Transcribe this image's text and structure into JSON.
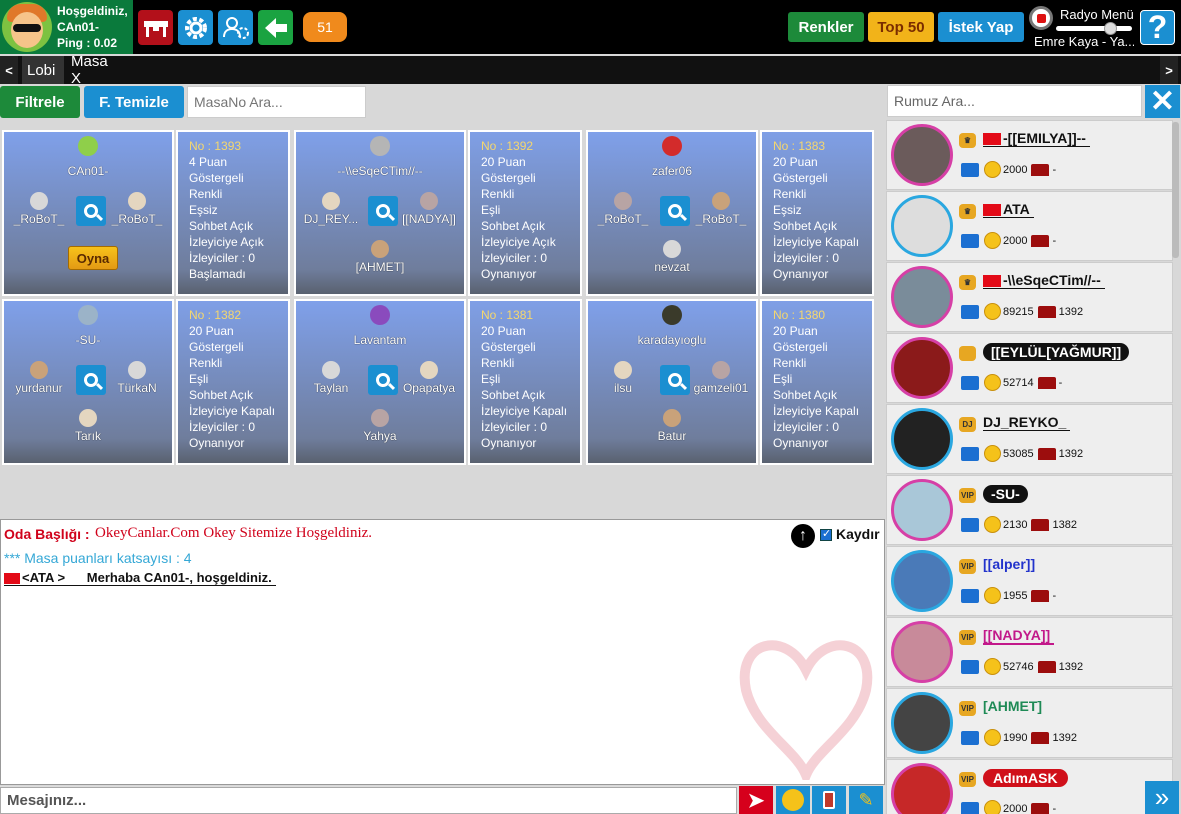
{
  "header": {
    "welcome_line1": "Hoşgeldiniz,",
    "welcome_line2": "CAn01-",
    "welcome_line3": "Ping : 0.02",
    "count_badge": "51",
    "renkler": "Renkler",
    "top50": "Top 50",
    "istek": "İstek Yap",
    "radio_label": "Radyo Menü",
    "radio_song": "Emre Kaya - Ya...",
    "help": "?"
  },
  "tabs": {
    "prev": "<",
    "lobi": "Lobi",
    "masa": "Masa X",
    "next": ">"
  },
  "filter": {
    "filtrele": "Filtrele",
    "temizle": "F. Temizle",
    "masa_placeholder": "MasaNo Ara..."
  },
  "tables": [
    {
      "owner": "CAn01-",
      "seat_left": "_RoBoT_",
      "seat_right": "_RoBoT_",
      "seat_bottom": "",
      "button": "Oyna",
      "info": {
        "no": "No : 1393",
        "puan": "4 Puan",
        "l1": "Göstergeli",
        "l2": "Renkli",
        "l3": "Eşsiz",
        "l4": "Sohbet Açık",
        "l5": "İzleyiciye Açık",
        "l6": "İzleyiciler : 0",
        "status": "Başlamadı"
      }
    },
    {
      "owner": "--\\\\eSqeCTim//--",
      "seat_left": "DJ_REY...",
      "seat_right": "[[NADYA]]",
      "seat_bottom": "[AHMET]",
      "button": "",
      "info": {
        "no": "No : 1392",
        "puan": "20 Puan",
        "l1": "Göstergeli",
        "l2": "Renkli",
        "l3": "Eşli",
        "l4": "Sohbet Açık",
        "l5": "İzleyiciye Açık",
        "l6": "İzleyiciler : 0",
        "status": "Oynanıyor"
      }
    },
    {
      "owner": "zafer06",
      "seat_left": "_RoBoT_",
      "seat_right": "_RoBoT_",
      "seat_bottom": "nevzat",
      "button": "",
      "info": {
        "no": "No : 1383",
        "puan": "20 Puan",
        "l1": "Göstergeli",
        "l2": "Renkli",
        "l3": "Eşsiz",
        "l4": "Sohbet Açık",
        "l5": "İzleyiciye Kapalı",
        "l6": "İzleyiciler : 0",
        "status": "Oynanıyor"
      }
    },
    {
      "owner": "-SU-",
      "seat_left": "yurdanur",
      "seat_right": "TürkaN",
      "seat_bottom": "Tarık",
      "button": "",
      "info": {
        "no": "No : 1382",
        "puan": "20 Puan",
        "l1": "Göstergeli",
        "l2": "Renkli",
        "l3": "Eşli",
        "l4": "Sohbet Açık",
        "l5": "İzleyiciye Kapalı",
        "l6": "İzleyiciler : 0",
        "status": "Oynanıyor"
      }
    },
    {
      "owner": "Lavantam",
      "seat_left": "Taylan",
      "seat_right": "Opapatya",
      "seat_bottom": "Yahya",
      "button": "",
      "info": {
        "no": "No : 1381",
        "puan": "20 Puan",
        "l1": "Göstergeli",
        "l2": "Renkli",
        "l3": "Eşli",
        "l4": "Sohbet Açık",
        "l5": "İzleyiciye Kapalı",
        "l6": "İzleyiciler : 0",
        "status": "Oynanıyor"
      }
    },
    {
      "owner": "karadayıoglu",
      "seat_left": "ilsu",
      "seat_right": "gamzeli01",
      "seat_bottom": "Batur",
      "button": "",
      "info": {
        "no": "No : 1380",
        "puan": "20 Puan",
        "l1": "Göstergeli",
        "l2": "Renkli",
        "l3": "Eşli",
        "l4": "Sohbet Açık",
        "l5": "İzleyiciye Kapalı",
        "l6": "İzleyiciler : 0",
        "status": "Oynanıyor"
      }
    }
  ],
  "chat": {
    "title_label": "Oda Başlığı :",
    "title_value": "OkeyCanlar.Com Okey Sitemize Hoşgeldiniz.",
    "system_line": "*** Masa puanları katsayısı : 4",
    "msg_sender": "<ATA >",
    "msg_text": "Merhaba CAn01-, hoşgeldiniz.",
    "kaydir": "Kaydır",
    "up": "↑",
    "input_placeholder": "Mesajınız...",
    "send": "➤",
    "brush": "✎"
  },
  "sidebar": {
    "search_placeholder": "Rumuz Ara...",
    "close": "✕",
    "more": "»",
    "users": [
      {
        "name": "-[[EMILYA]]--",
        "badge": "♛",
        "coins": "2000",
        "table": "-"
      },
      {
        "name": "ATA",
        "badge": "♛",
        "coins": "2000",
        "table": "-"
      },
      {
        "name": "-\\\\eSqeCTim//--",
        "badge": "♛",
        "coins": "89215",
        "table": "1392"
      },
      {
        "name": "[[EYLÜL[YAĞMUR]]",
        "badge": "",
        "coins": "52714",
        "table": "-"
      },
      {
        "name": "DJ_REYKO_",
        "badge": "DJ",
        "coins": "53085",
        "table": "1392"
      },
      {
        "name": "-SU-",
        "badge": "VIP",
        "coins": "2130",
        "table": "1382"
      },
      {
        "name": "[[alper]]",
        "badge": "VIP",
        "coins": "1955",
        "table": "-"
      },
      {
        "name": "[[NADYA]]",
        "badge": "VIP",
        "coins": "52746",
        "table": "1392"
      },
      {
        "name": "[AHMET]",
        "badge": "VIP",
        "coins": "1990",
        "table": "1392"
      },
      {
        "name": "AdımASK",
        "badge": "VIP",
        "coins": "2000",
        "table": "-"
      }
    ]
  },
  "colors": {
    "green": "#1d8a3a",
    "blue": "#1b8fd1",
    "red": "#d0021b",
    "gold": "#f2b319"
  }
}
